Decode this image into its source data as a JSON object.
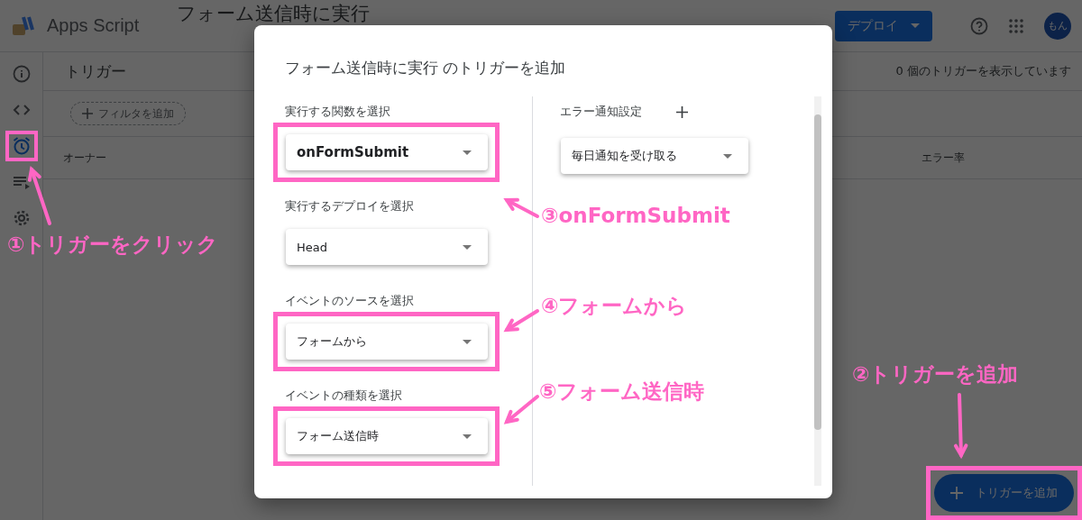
{
  "app": {
    "name": "Apps Script",
    "project": "フォーム送信時に実行",
    "deploy_button": "デプロイ",
    "avatar": "もん"
  },
  "rail": [
    {
      "kind": "info",
      "selected": false,
      "highlighted": false
    },
    {
      "kind": "code",
      "selected": false,
      "highlighted": false
    },
    {
      "kind": "triggers",
      "selected": true,
      "highlighted": true
    },
    {
      "kind": "executions",
      "selected": false,
      "highlighted": false
    },
    {
      "kind": "settings",
      "selected": false,
      "highlighted": false
    }
  ],
  "page": {
    "title": "トリガー",
    "count": "0 個のトリガーを表示しています",
    "filter_button": "フィルタを追加",
    "columns": [
      "オーナー",
      "エラー率"
    ],
    "add_button": {
      "label": "トリガーを追加",
      "highlighted": true
    }
  },
  "dialog": {
    "title": "フォーム送信時に実行 のトリガーを追加",
    "fields": [
      {
        "label": "実行する関数を選択",
        "value": "onFormSubmit",
        "emphasized": true,
        "highlighted": true
      },
      {
        "label": "実行するデプロイを選択",
        "value": "Head",
        "emphasized": false,
        "highlighted": false
      },
      {
        "label": "イベントのソースを選択",
        "value": "フォームから",
        "emphasized": false,
        "highlighted": true
      },
      {
        "label": "イベントの種類を選択",
        "value": "フォーム送信時",
        "emphasized": false,
        "highlighted": true
      }
    ],
    "error_notify": {
      "label": "エラー通知設定",
      "value": "毎日通知を受け取る"
    }
  },
  "annotations": [
    {
      "text": "①トリガーをクリック"
    },
    {
      "text": "③onFormSubmit"
    },
    {
      "text": "④フォームから"
    },
    {
      "text": "⑤フォーム送信時"
    },
    {
      "text": "②トリガーを追加"
    }
  ]
}
